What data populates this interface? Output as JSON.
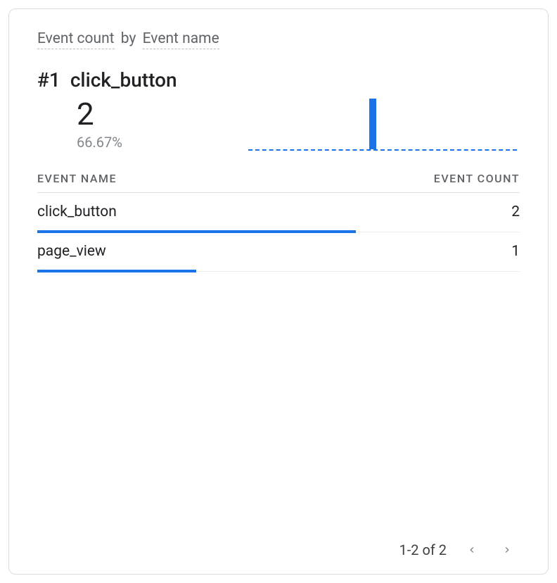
{
  "card": {
    "title_metric": "Event count",
    "title_by": "by",
    "title_dimension": "Event name",
    "rank_label": "#1",
    "top_event": "click_button",
    "top_value": "2",
    "top_pct": "66.67%"
  },
  "table": {
    "col_name": "EVENT NAME",
    "col_value": "EVENT COUNT",
    "rows": [
      {
        "name": "click_button",
        "value": "2",
        "barpct": 66.0
      },
      {
        "name": "page_view",
        "value": "1",
        "barpct": 33.0
      }
    ]
  },
  "pager": {
    "range_label": "1-2 of 2"
  },
  "chart_data": {
    "type": "bar",
    "title": "Event count by Event name",
    "xlabel": "Event name",
    "ylabel": "Event count",
    "categories": [
      "click_button",
      "page_view"
    ],
    "values": [
      2,
      1
    ],
    "ylim": [
      0,
      2
    ]
  }
}
